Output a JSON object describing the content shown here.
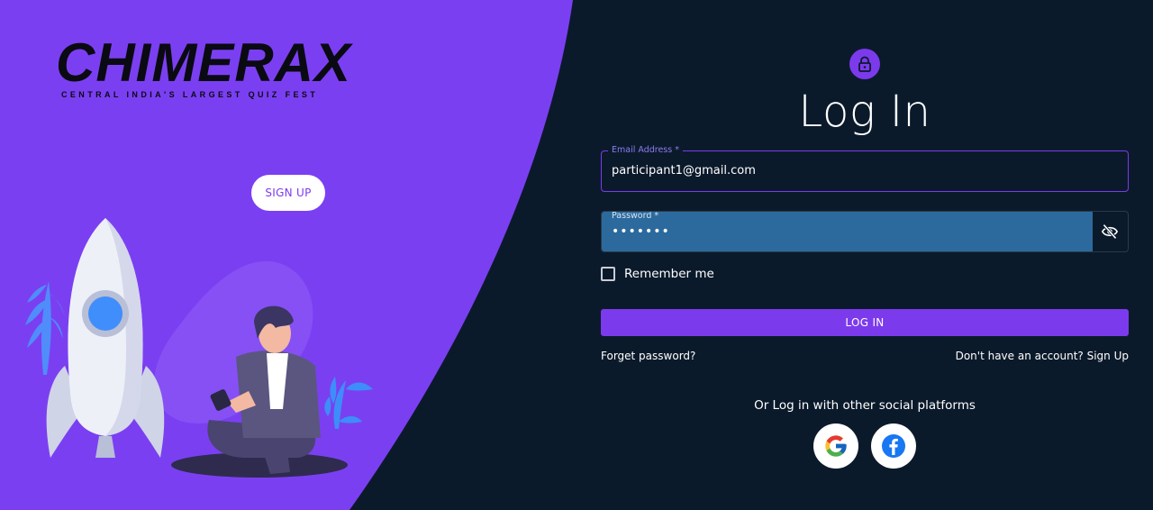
{
  "brand": {
    "logo_text": "CHIMERAX",
    "tagline": "CENTRAL INDIA'S LARGEST QUIZ FEST"
  },
  "left_panel": {
    "signup_button": "SIGN UP"
  },
  "login": {
    "title": "Log In",
    "email": {
      "label": "Email Address *",
      "value": "participant1@gmail.com"
    },
    "password": {
      "label": "Password *",
      "value": "•••••••"
    },
    "remember_label": "Remember me",
    "submit_label": "LOG IN",
    "forgot_label": "Forget password?",
    "signup_prompt": "Don't have an account? Sign Up",
    "social_prompt": "Or Log in with other social platforms"
  },
  "icons": {
    "lock": "lock-icon",
    "visibility": "visibility-off-icon",
    "google": "google-icon",
    "facebook": "facebook-icon"
  },
  "colors": {
    "accent": "#7c3aed",
    "panel_left": "#7b3ff2",
    "panel_right": "#0b1a2b",
    "password_fill": "#2c6a9d",
    "facebook": "#1877f2",
    "google": "#4285f4"
  }
}
